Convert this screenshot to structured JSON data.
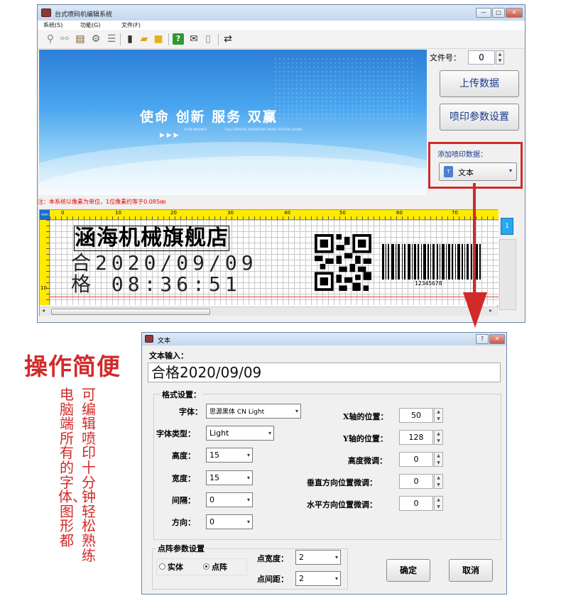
{
  "app": {
    "title": "台式喷码机编辑系统",
    "menus": [
      "系统(S)",
      "功能(G)",
      "文件(F)"
    ],
    "window_controls": [
      "—",
      "□",
      "✕"
    ]
  },
  "toolbar": {
    "icons": [
      "link-icon",
      "unlink-icon",
      "settings-doc-icon",
      "gear-icon",
      "database-icon",
      "usb-drive-icon",
      "open-folder-icon",
      "save-icon",
      "help-icon",
      "mail-icon",
      "trash-icon",
      "sync-icon"
    ]
  },
  "banner": {
    "slogan": "使命  创新  服务  双赢",
    "tag1": "PLAN ENHANCE",
    "tag2": "FULL CREATIVE ADVANTAGES",
    "tag3": "MORE CREATIVE SHOWS"
  },
  "panel": {
    "file_no_label": "文件号：",
    "file_no_value": "0",
    "upload_button": "上传数据",
    "print_settings_button": "喷印参数设置",
    "add_data_label": "添加喷印数据：",
    "add_data_selected": "文本"
  },
  "note": "注：本系统以像素为单位，1位像素约等于0.085㎜",
  "ruler": {
    "corner": "mm",
    "top_labels": [
      "0",
      "10",
      "20",
      "30",
      "40",
      "50",
      "60",
      "70"
    ],
    "left_label": "10"
  },
  "canvas": {
    "line1": "涵海机械旗舰店",
    "line2": "合2020/09/09",
    "line3": "格  08:36:51",
    "barcode_number": "12345678",
    "page_button": "1"
  },
  "promo": {
    "headline": "操作简便",
    "col1": "可编辑喷印十分钟轻松熟练",
    "col2": "电脑端所有的字体、图形都"
  },
  "dialog": {
    "title": "文本",
    "text_input_label": "文本输入：",
    "text_input_value": "合格2020/09/09",
    "format_group": "格式设置：",
    "font_label": "字体：",
    "font_value": "思源黑体 CN Light",
    "font_type_label": "字体类型：",
    "font_type_value": "Light",
    "height_label": "高度：",
    "height_value": "15",
    "width_label": "宽度：",
    "width_value": "15",
    "spacing_label": "间隔：",
    "spacing_value": "0",
    "direction_label": "方向：",
    "direction_value": "0",
    "x_label": "X轴的位置：",
    "x_value": "50",
    "y_label": "Y轴的位置：",
    "y_value": "128",
    "height_fine_label": "高度微调：",
    "height_fine_value": "0",
    "vfine_label": "垂直方向位置微调：",
    "vfine_value": "0",
    "hfine_label": "水平方向位置微调：",
    "hfine_value": "0",
    "dot_group": "点阵参数设置",
    "radio_solid": "实体",
    "radio_dot": "点阵",
    "dot_width_label": "点宽度：",
    "dot_width_value": "2",
    "dot_spacing_label": "点间距：",
    "dot_spacing_value": "2",
    "ok_button": "确定",
    "cancel_button": "取消",
    "help_btn": "?",
    "close_btn": "✕"
  },
  "colors": {
    "accent_red": "#d12a2a",
    "ruler_yellow": "#ffea00",
    "banner_blue": "#2c7fd6"
  }
}
